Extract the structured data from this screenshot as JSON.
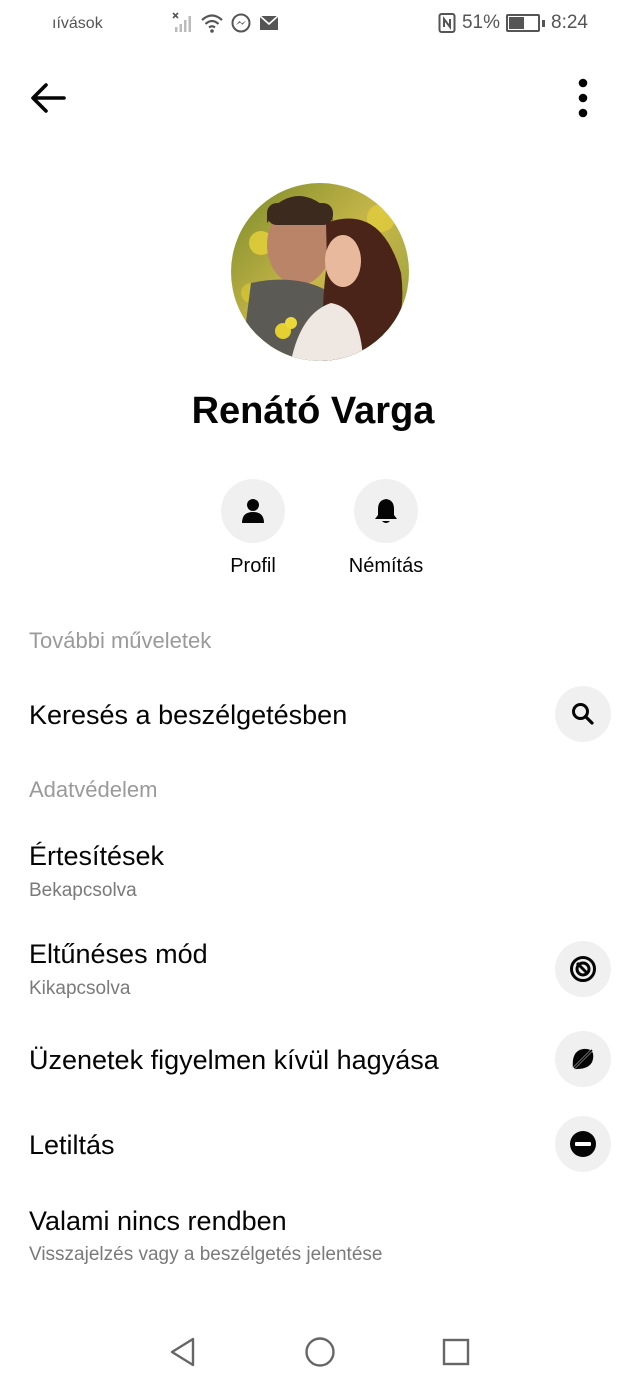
{
  "status_bar": {
    "left_text": "ıívások",
    "battery_percent": "51%",
    "time": "8:24",
    "icons": [
      "no-signal-icon",
      "wifi-icon",
      "messenger-icon",
      "mail-icon",
      "nfc-icon",
      "battery-icon"
    ]
  },
  "header": {
    "back_icon": "arrow-left-icon",
    "more_icon": "more-vertical-icon"
  },
  "contact": {
    "name": "Renátó Varga"
  },
  "actions": [
    {
      "label": "Profil",
      "icon": "person-icon"
    },
    {
      "label": "Némítás",
      "icon": "bell-icon"
    }
  ],
  "sections": {
    "more_actions": "További műveletek",
    "privacy": "Adatvédelem"
  },
  "rows": {
    "search": {
      "title": "Keresés a beszélgetésben",
      "icon": "search-icon"
    },
    "notifications": {
      "title": "Értesítések",
      "subtitle": "Bekapcsolva"
    },
    "vanish": {
      "title": "Eltűnéses mód",
      "subtitle": "Kikapcsolva",
      "icon": "vanish-mode-icon"
    },
    "ignore": {
      "title": "Üzenetek figyelmen kívül hagyása",
      "icon": "ignore-icon"
    },
    "block": {
      "title": "Letiltás",
      "icon": "block-icon"
    },
    "report": {
      "title": "Valami nincs rendben",
      "subtitle": "Visszajelzés vagy a beszélgetés jelentése"
    }
  },
  "nav": {
    "icons": [
      "back-triangle-icon",
      "home-circle-icon",
      "recents-square-icon"
    ]
  },
  "colors": {
    "background": "#ffffff",
    "icon_bg": "#f0f0f0",
    "section_text": "#9a9a9a",
    "subtitle_text": "#7a7a7a"
  }
}
